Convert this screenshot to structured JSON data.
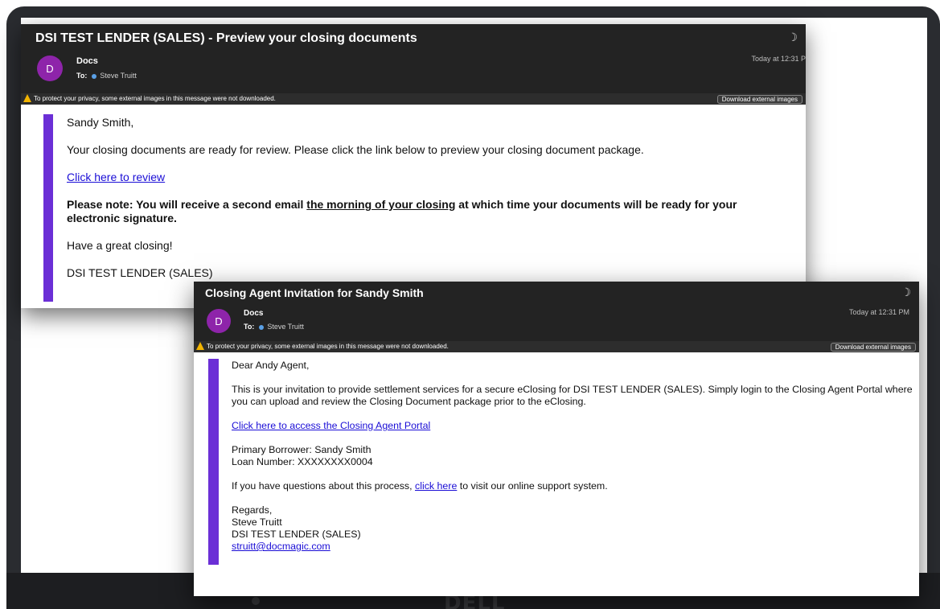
{
  "device": {
    "logo_text": "DELL"
  },
  "email1": {
    "subject": "DSI TEST LENDER (SALES) - Preview your closing documents",
    "avatar_letter": "D",
    "from": "Docs",
    "to_label": "To:",
    "to_name": "Steve Truitt",
    "date": "Today at 12:31 P",
    "privacy_text": "To protect your privacy, some external images in this message were not downloaded.",
    "download_button": "Download external images",
    "greeting": "Sandy Smith,",
    "intro": "Your closing documents are ready for review. Please click the link below to preview your closing document package.",
    "review_link": "Click here to review",
    "note_part1": "Please note: You will receive a second email ",
    "note_underlined": "the morning of your closing",
    "note_part2": " at which time your documents will be ready for your electronic signature.",
    "closing_wish": "Have a great closing!",
    "signature": "DSI TEST LENDER (SALES)"
  },
  "email2": {
    "subject": "Closing Agent Invitation for Sandy Smith",
    "avatar_letter": "D",
    "from": "Docs",
    "to_label": "To:",
    "to_name": "Steve Truitt",
    "date": "Today at 12:31 PM",
    "privacy_text": "To protect your privacy, some external images in this message were not downloaded.",
    "download_button": "Download external images",
    "greeting": "Dear Andy Agent,",
    "intro": "This is your invitation to provide settlement services for a secure eClosing for DSI TEST LENDER (SALES). Simply login to the Closing Agent Portal where you can upload and review the Closing Document package prior to the eClosing.",
    "portal_link": "Click here to access the Closing Agent Portal",
    "primary_borrower": "Primary Borrower: Sandy Smith",
    "loan_number": "Loan Number: XXXXXXXX0004",
    "questions_part1": "If you have questions about this process, ",
    "questions_link": "click here",
    "questions_part2": " to visit our online support system.",
    "regards": "Regards,",
    "sig_name": "Steve Truitt",
    "sig_company": "DSI TEST LENDER (SALES)",
    "sig_email": "struitt@docmagic.com"
  },
  "colors": {
    "accent_bar": "#6b2fd6",
    "avatar": "#8e24aa",
    "link": "#1a0dd6",
    "header_bg": "#232323"
  }
}
